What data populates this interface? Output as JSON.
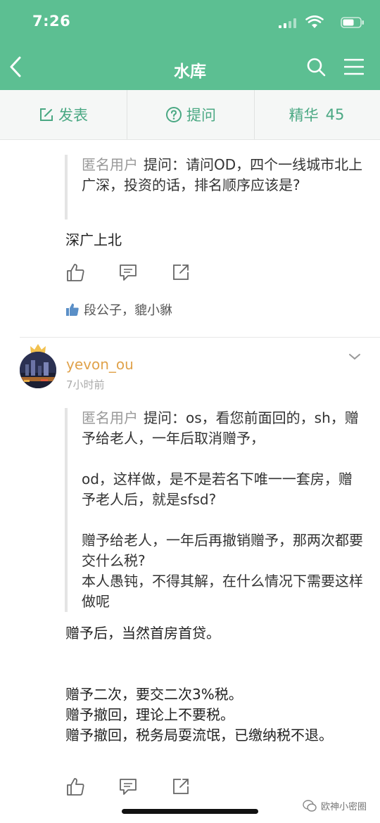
{
  "status_bar": {
    "time": "7:26"
  },
  "nav": {
    "title": "水库"
  },
  "actions": {
    "post_label": "发表",
    "ask_label": "提问",
    "best_label": "精华",
    "best_count": "45"
  },
  "posts": [
    {
      "quote_author": "匿名用户",
      "quote_text": "提问：请问OD，四个一线城市北上广深，投资的话，排名顺序应该是?",
      "answer_text": "深广上北",
      "likes_text": "段公子，貔小貅"
    },
    {
      "author": "yevon_ou",
      "time": "7小时前",
      "quote_author": "匿名用户",
      "quote_text": "提问：os，看您前面回的，sh，赠予给老人，一年后取消赠予，\n\nod，这样做，是不是若名下唯一一套房，赠予老人后，就是sfsd?\n\n赠予给老人，一年后再撤销赠予，那两次都要交什么税?\n本人愚钝，不得其解，在什么情况下需要这样做呢",
      "answer_text": "赠予后，当然首房首贷。\n\n\n赠予二次，要交二次3%税。\n赠予撤回，理论上不要税。\n赠予撤回，税务局耍流氓，已缴纳税不退。"
    }
  ],
  "watermark": {
    "text": "欧神小密圈"
  },
  "colors": {
    "brand": "#5cbf92",
    "accent": "#4aa883",
    "username": "#e0a24b"
  }
}
